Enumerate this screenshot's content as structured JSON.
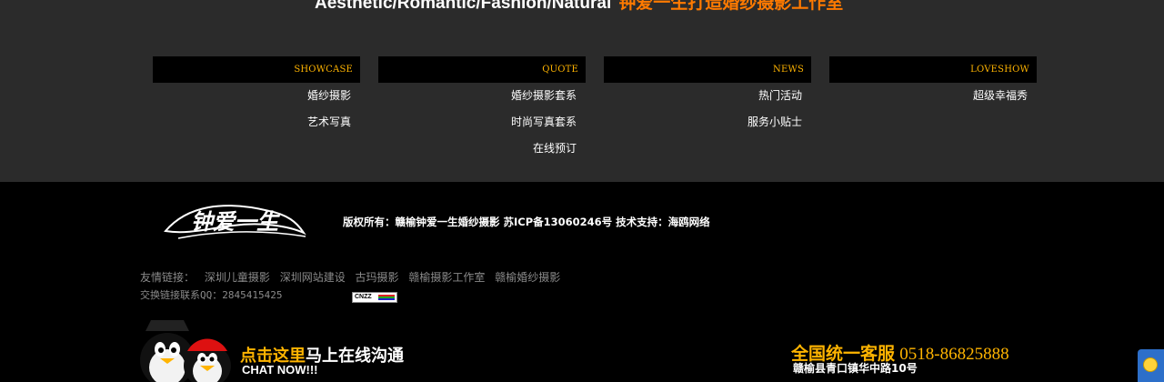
{
  "slogan": {
    "en": "Aesthetic/Romantic/Fashion/Natural",
    "cn": "钟爱一生打造婚纱摄影工作室"
  },
  "columns": [
    {
      "title": "SHOWCASE",
      "items": [
        "婚纱摄影",
        "艺术写真"
      ]
    },
    {
      "title": "QUOTE",
      "items": [
        "婚纱摄影套系",
        "时尚写真套系",
        "在线预订"
      ]
    },
    {
      "title": "NEWS",
      "items": [
        "热门活动",
        "服务小贴士"
      ]
    },
    {
      "title": "LOVESHOW",
      "items": [
        "超级幸福秀"
      ]
    }
  ],
  "logo": {
    "text": "钟爱一生"
  },
  "footer": {
    "copyright": "版权所有：赣榆钟爱一生婚纱摄影 苏ICP备13060246号 技术支持：海鸥网络",
    "links_label": "友情链接：",
    "links": [
      "深圳儿童摄影",
      "深圳网站建设",
      "古玛摄影",
      "赣榆摄影工作室",
      "赣榆婚纱摄影"
    ],
    "qq": "交换链接联系QQ：2845415425",
    "cnzz": "CNZZ"
  },
  "chat": {
    "line1_highlight": "点击这里",
    "line1_rest": "马上在线沟通",
    "line2": "CHAT NOW!!!"
  },
  "service": {
    "label": "全国统一客服",
    "phone": "0518-86825888",
    "address": "赣榆县青口镇华中路10号"
  },
  "colors": {
    "accent": "#ffb400",
    "slogan_accent": "#ff7a00",
    "band": "#2b2b2b"
  }
}
